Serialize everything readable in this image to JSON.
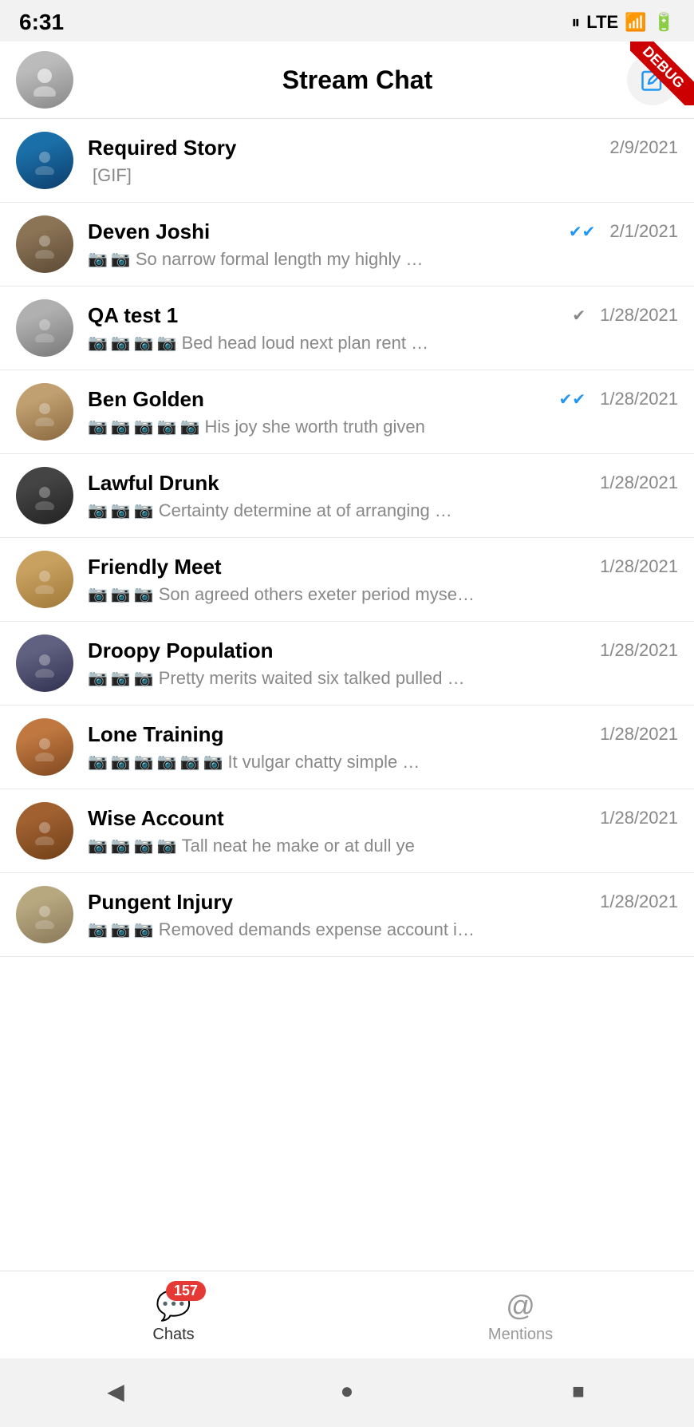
{
  "statusBar": {
    "time": "6:31",
    "lte": "LTE"
  },
  "header": {
    "title": "Stream Chat",
    "editLabel": "edit"
  },
  "chats": [
    {
      "id": 1,
      "name": "Required Story",
      "preview": "[GIF]",
      "date": "2/9/2021",
      "avatarClass": "avatar-ocean",
      "cameraIcons": 0,
      "checkStyle": "none"
    },
    {
      "id": 2,
      "name": "Deven Joshi",
      "preview": "So narrow formal length my highly …",
      "date": "2/1/2021",
      "avatarClass": "avatar-person1",
      "cameraIcons": 2,
      "checkStyle": "blue"
    },
    {
      "id": 3,
      "name": "QA test 1",
      "preview": "Bed head loud next plan rent …",
      "date": "1/28/2021",
      "avatarClass": "avatar-person2",
      "cameraIcons": 4,
      "checkStyle": "single"
    },
    {
      "id": 4,
      "name": "Ben Golden",
      "preview": "His joy she worth truth given",
      "date": "1/28/2021",
      "avatarClass": "avatar-person3",
      "cameraIcons": 5,
      "checkStyle": "blue"
    },
    {
      "id": 5,
      "name": "Lawful Drunk",
      "preview": "Certainty determine at of arranging …",
      "date": "1/28/2021",
      "avatarClass": "avatar-dark",
      "cameraIcons": 3,
      "checkStyle": "none"
    },
    {
      "id": 6,
      "name": "Friendly Meet",
      "preview": "Son agreed others exeter period myse…",
      "date": "1/28/2021",
      "avatarClass": "avatar-desert",
      "cameraIcons": 3,
      "checkStyle": "none"
    },
    {
      "id": 7,
      "name": "Droopy Population",
      "preview": "Pretty merits waited six talked pulled …",
      "date": "1/28/2021",
      "avatarClass": "avatar-city",
      "cameraIcons": 3,
      "checkStyle": "none"
    },
    {
      "id": 8,
      "name": "Lone Training",
      "preview": "It vulgar chatty simple …",
      "date": "1/28/2021",
      "avatarClass": "avatar-sunset",
      "cameraIcons": 6,
      "checkStyle": "none"
    },
    {
      "id": 9,
      "name": "Wise Account",
      "preview": "Tall neat he make or at dull ye",
      "date": "1/28/2021",
      "avatarClass": "avatar-wood",
      "cameraIcons": 4,
      "checkStyle": "none"
    },
    {
      "id": 10,
      "name": "Pungent Injury",
      "preview": "Removed demands expense account i…",
      "date": "1/28/2021",
      "avatarClass": "avatar-pier",
      "cameraIcons": 3,
      "checkStyle": "none"
    }
  ],
  "bottomNav": {
    "chats": {
      "label": "Chats",
      "badge": "157"
    },
    "mentions": {
      "label": "Mentions"
    }
  },
  "androidNav": {
    "back": "◀",
    "home": "●",
    "recents": "■"
  }
}
